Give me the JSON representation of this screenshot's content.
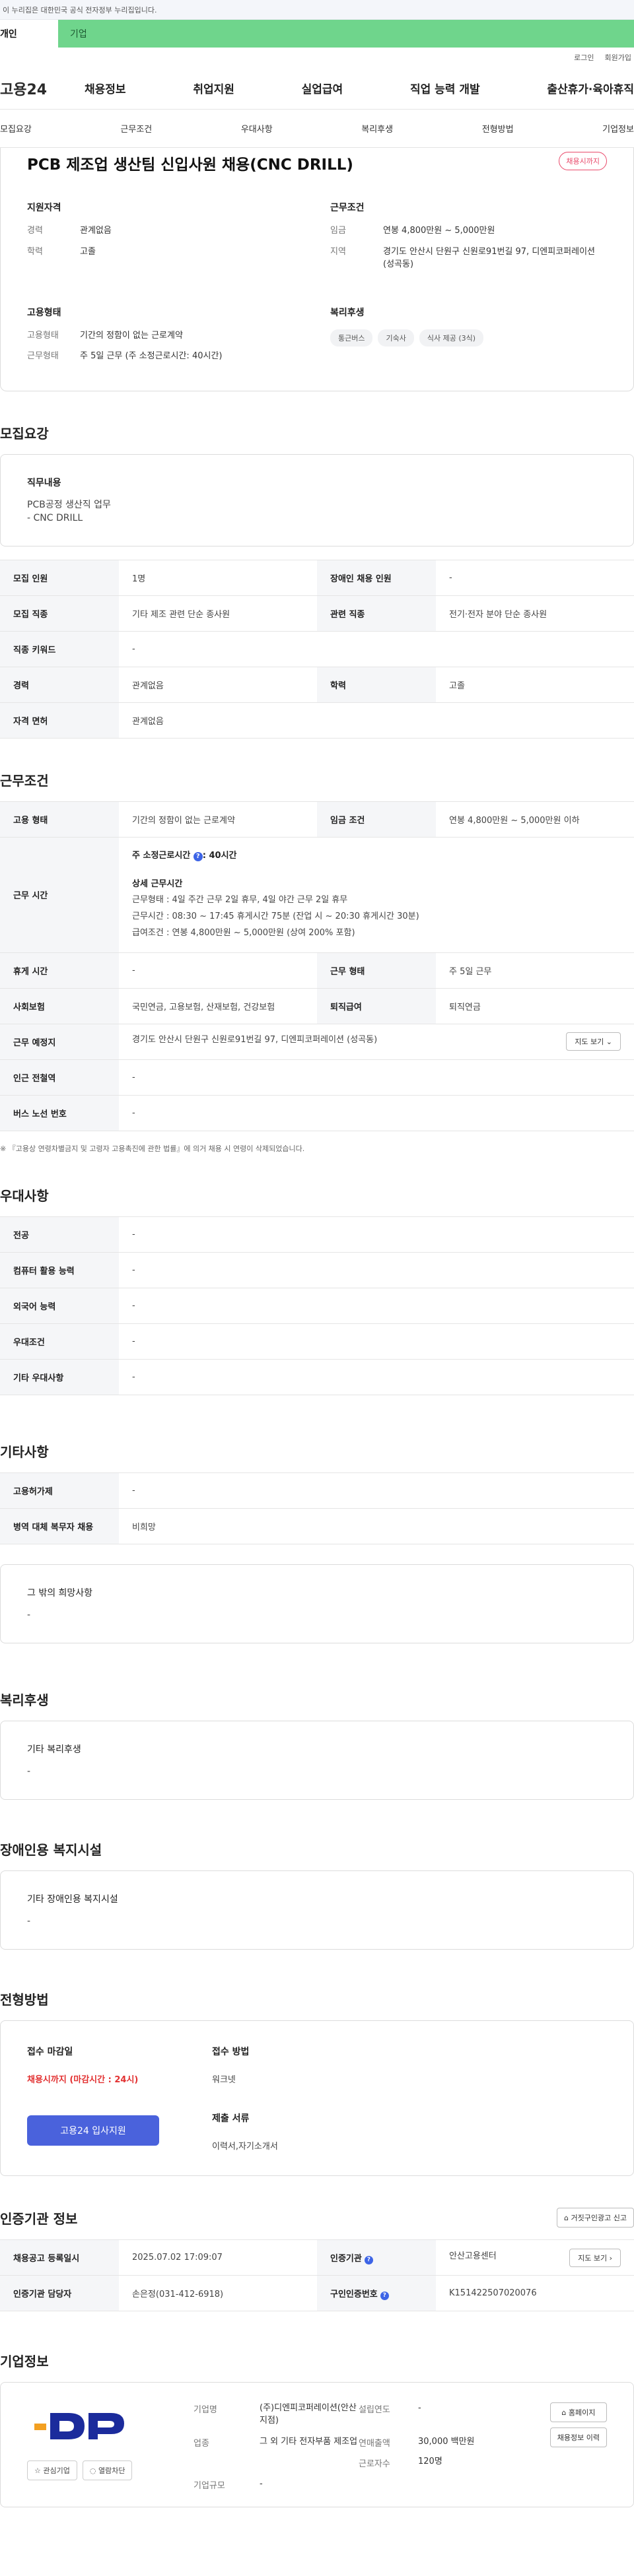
{
  "gov_bar": "이 누리집은 대한민국 공식 전자정부 누리집입니다.",
  "tabs": {
    "personal": "개인",
    "company": "기업"
  },
  "utility": {
    "login": "로그인",
    "join": "회원가입"
  },
  "logo": "고용24",
  "gnb": [
    "채용정보",
    "취업지원",
    "실업급여",
    "직업 능력 개발",
    "출산휴가·육아휴직"
  ],
  "subnav": [
    "모집요강",
    "근무조건",
    "우대사항",
    "복리후생",
    "전형방법",
    "기업정보"
  ],
  "summary": {
    "title": "PCB 제조업 생산팀 신입사원 채용(CNC DRILL)",
    "badge": "채용시까지",
    "qual_head": "지원자격",
    "career_label": "경력",
    "career": "관계없음",
    "edu_label": "학력",
    "edu": "고졸",
    "cond_head": "근무조건",
    "wage_label": "임금",
    "wage": "연봉 4,800만원 ~ 5,000만원",
    "loc_label": "지역",
    "loc": "경기도 안산시 단원구 신원로91번길 97, 디엔피코퍼레이션 (성곡동)",
    "emp_head": "고용형태",
    "emp_label": "고용형태",
    "emp": "기간의 정함이 없는 근로계약",
    "form_label": "근무형태",
    "form": "주 5일 근무 (주 소정근로시간: 40시간)",
    "welfare_head": "복리후생",
    "chips": [
      "통근버스",
      "기숙사",
      "식사 제공 (3식)"
    ]
  },
  "recruit": {
    "title": "모집요강",
    "duty_head": "직무내용",
    "duty_text": "PCB공정 생산직 업무\n- CNC DRILL",
    "rows": [
      [
        "모집 인원",
        "1명",
        "장애인 채용 인원",
        "-"
      ],
      [
        "모집 직종",
        "기타 제조 관련 단순 종사원",
        "관련 직종",
        "전기·전자 분야 단순 종사원"
      ],
      [
        "직종 키워드",
        "-"
      ],
      [
        "경력",
        "관계없음",
        "학력",
        "고졸"
      ],
      [
        "자격 면허",
        "관계없음"
      ]
    ]
  },
  "work": {
    "title": "근무조건",
    "emp_label": "고용 형태",
    "emp": "기간의 정함이 없는 근로계약",
    "wage_label": "임금 조건",
    "wage": "연봉 4,800만원 ~ 5,000만원 이하",
    "hours_label": "근무 시간",
    "hours_title": "주 소정근로시간",
    "hours_value": ": 40시간",
    "detail_title": "상세 근무시간",
    "detail_lines": [
      "근무형태 : 4일 주간 근무 2일 휴무, 4일 야간 근무 2일 휴무",
      "근무시간 : 08:30 ~ 17:45 휴게시간 75분 (잔업 시 ~ 20:30 휴게시간 30분)",
      "급여조건 : 연봉 4,800만원 ~ 5,000만원 (상여 200% 포함)"
    ],
    "break_label": "휴게 시간",
    "break": "-",
    "form_label": "근무 형태",
    "form": "주 5일 근무",
    "insure_label": "사회보험",
    "insure": "국민연금, 고용보험, 산재보험, 건강보험",
    "retire_label": "퇴직급여",
    "retire": "퇴직연금",
    "place_label": "근무 예정지",
    "place": "경기도 안산시 단원구 신원로91번길 97, 디엔피코퍼레이션 (성곡동)",
    "map_btn": "지도 보기",
    "subway_label": "인근 전철역",
    "subway": "-",
    "bus_label": "버스 노선 번호",
    "bus": "-",
    "note": "※ 『고용상 연령차별금지 및 고령자 고용촉진에 관한 법률』에 의거 채용 시 연령이 삭제되었습니다."
  },
  "prefer": {
    "title": "우대사항",
    "rows": [
      [
        "전공",
        "-"
      ],
      [
        "컴퓨터 활용 능력",
        "-"
      ],
      [
        "외국어 능력",
        "-"
      ],
      [
        "우대조건",
        "-"
      ],
      [
        "기타 우대사항",
        "-"
      ]
    ]
  },
  "etc": {
    "title": "기타사항",
    "rows": [
      [
        "고용허가제",
        "-"
      ],
      [
        "병역 대체 복무자 채용",
        "비희망"
      ]
    ],
    "wish_head": "그 밖의 희망사항",
    "wish": "-"
  },
  "welfare": {
    "title": "복리후생",
    "head": "기타 복리후생",
    "value": "-"
  },
  "disability": {
    "title": "장애인용 복지시설",
    "head": "기타 장애인용 복지시설",
    "value": "-"
  },
  "apply": {
    "title": "전형방법",
    "deadline_head": "접수 마감일",
    "deadline": "채용시까지 (마감시간 : 24시)",
    "apply_btn": "고용24 입사지원",
    "method_head": "접수 방법",
    "method": "워크넷",
    "docs_head": "제출 서류",
    "docs": "이력서,자기소개서"
  },
  "agency": {
    "title": "인증기관 정보",
    "report_btn": "거짓구인광고 신고",
    "reg_label": "채용공고 등록일시",
    "reg": "2025.07.02 17:09:07",
    "cert_label": "인증기관",
    "cert": "안산고용센터",
    "map_btn": "지도 보기",
    "staff_label": "인증기관 담당자",
    "staff": "손은정(031-412-6918)",
    "num_label": "구인인증번호",
    "num": "K151422507020076"
  },
  "company": {
    "title": "기업정보",
    "logo_text": "DP",
    "interest_btn": "관심기업",
    "block_btn": "열람차단",
    "name_label": "기업명",
    "name": "(주)디엔피코퍼레이션(안산지점)",
    "year_label": "설립연도",
    "year": "-",
    "industry_label": "업종",
    "industry": "그 외 기타 전자부품 제조업",
    "sales_label": "연매출액",
    "sales": "30,000 백만원",
    "emp_label": "근로자수",
    "emp": "120명",
    "size_label": "기업규모",
    "size": "-",
    "home_btn": "홈페이지",
    "history_btn": "채용정보 이력",
    "brand_color": "#1b2b9c",
    "accent_color": "#f3a021"
  }
}
